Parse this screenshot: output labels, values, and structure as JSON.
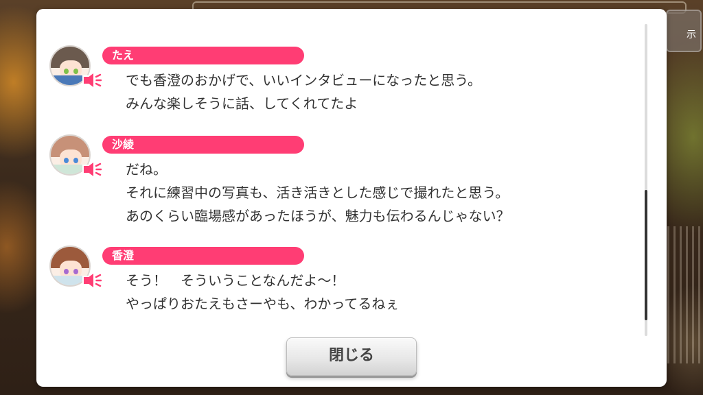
{
  "background": {
    "side_button_label": "示"
  },
  "colors": {
    "name_bar": "#ff3d74",
    "voice_icon": "#ff3d74",
    "text": "#333333"
  },
  "dialogue": [
    {
      "speaker": "たえ",
      "lines": [
        "でも香澄のおかげで、いいインタビューになったと思う。",
        "みんな楽しそうに話、してくれてたよ"
      ],
      "avatar": {
        "hair": "#6b5a4e",
        "eyes": "#7fc04a",
        "cloth": "#4a79b8"
      },
      "voice_icon": "speaker-icon"
    },
    {
      "speaker": "沙綾",
      "lines": [
        "だね。",
        "それに練習中の写真も、活き活きとした感じで撮れたと思う。",
        "あのくらい臨場感があったほうが、魅力も伝わるんじゃない？"
      ],
      "avatar": {
        "hair": "#c79178",
        "eyes": "#4a8ad8",
        "cloth": "#cfe6d8"
      },
      "voice_icon": "speaker-icon"
    },
    {
      "speaker": "香澄",
      "lines": [
        "そう！　そういうことなんだよ～！",
        "やっぱりおたえもさーやも、わかってるねぇ"
      ],
      "avatar": {
        "hair": "#9c5a3c",
        "eyes": "#a66ad0",
        "cloth": "#cfe3ec"
      },
      "voice_icon": "speaker-icon"
    }
  ],
  "close_button": {
    "label": "閉じる"
  }
}
